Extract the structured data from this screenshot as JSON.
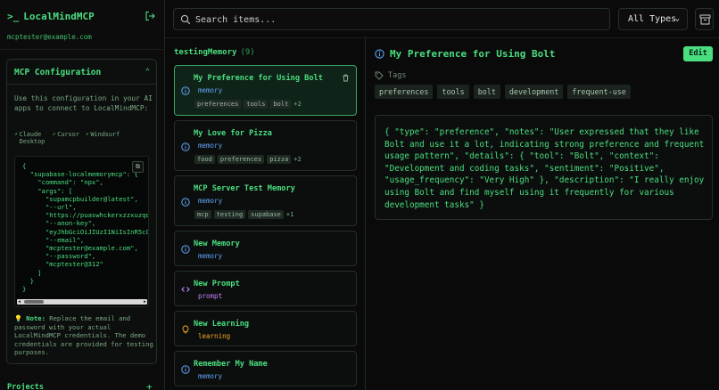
{
  "app": {
    "prompt_symbol": ">_",
    "name": "LocalMindMCP",
    "user_email": "mcptester@example.com"
  },
  "mcp": {
    "title": "MCP Configuration",
    "description": "Use this configuration in your AI apps to connect to LocalMindMCP:",
    "clients": [
      "Claude Desktop",
      "Cursor",
      "Windsurf"
    ],
    "config_code": "{\n  \"supabase-localmemorymcp\": {\n    \"command\": \"npx\",\n    \"args\": [\n      \"supamcpbuilder@latest\",\n      \"--url\",\n      \"https://puaswhckerxzzxuzqqu\n      \"--anon-key\",\n      \"eyJhbGciOiJIUzI1NiIsInR5cC\n      \"--email\",\n      \"mcptester@example.com\",\n      \"--password\",\n      \"mcptester@312\"\n    ]\n  }\n}",
    "note_label": "Note:",
    "note_text": "Replace the email and password with your actual LocalMindMCP credentials. The demo credentials are provided for testing purposes."
  },
  "projects": {
    "label": "Projects"
  },
  "search": {
    "placeholder": "Search items..."
  },
  "type_filter": {
    "selected": "All Types"
  },
  "list": {
    "folder": "testingMemory",
    "count": "(9)",
    "items": [
      {
        "title": "My Preference for Using Bolt",
        "type": "memory",
        "tags": [
          "preferences",
          "tools",
          "bolt"
        ],
        "more": "+2",
        "icon": "info-icon"
      },
      {
        "title": "My Love for Pizza",
        "type": "memory",
        "tags": [
          "food",
          "preferences",
          "pizza"
        ],
        "more": "+2",
        "icon": "info-icon"
      },
      {
        "title": "MCP Server Test Memory",
        "type": "memory",
        "tags": [
          "mcp",
          "testing",
          "supabase"
        ],
        "more": "+1",
        "icon": "info-icon"
      },
      {
        "title": "New Memory",
        "type": "memory",
        "icon": "info-icon"
      },
      {
        "title": "New Prompt",
        "type": "prompt",
        "icon": "code-icon"
      },
      {
        "title": "New Learning",
        "type": "learning",
        "icon": "lightbulb-icon"
      },
      {
        "title": "Remember My Name",
        "type": "memory",
        "icon": "info-icon"
      }
    ]
  },
  "detail": {
    "title": "My Preference for Using Bolt",
    "edit_label": "Edit",
    "tags_label": "Tags",
    "tags": [
      "preferences",
      "tools",
      "bolt",
      "development",
      "frequent-use"
    ],
    "content": "{ \"type\": \"preference\", \"notes\": \"User expressed that they like Bolt and use it a lot, indicating strong preference and frequent usage pattern\", \"details\": { \"tool\": \"Bolt\", \"context\": \"Development and coding tasks\", \"sentiment\": \"Positive\", \"usage_frequency\": \"Very High\" }, \"description\": \"I really enjoy using Bolt and find myself using it frequently for various development tasks\" }"
  },
  "colors": {
    "accent": "#4ade80",
    "prompt_type": "#c084fc",
    "learning_type": "#f5a524",
    "memory_type": "#60a5fa"
  }
}
